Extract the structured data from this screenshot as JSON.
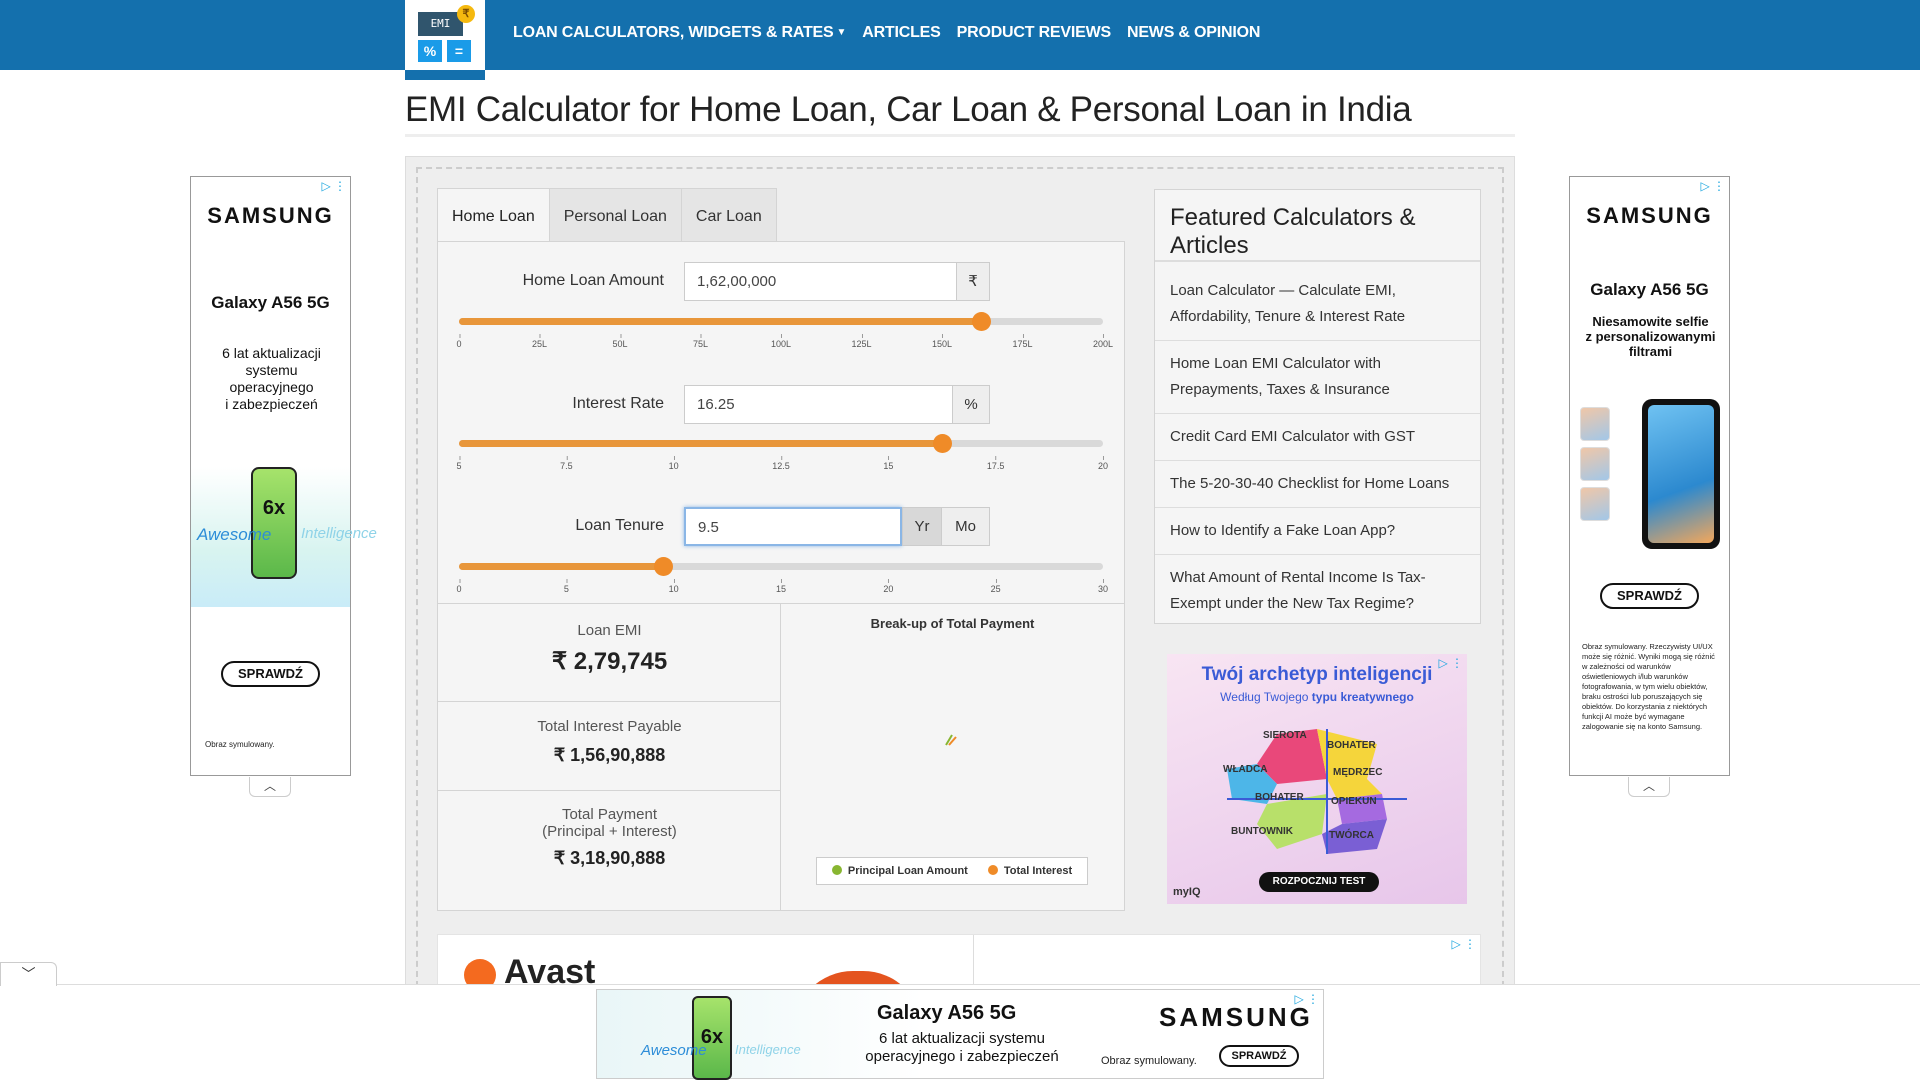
{
  "header": {
    "logo_screen": "EMI",
    "logo_coin": "₹",
    "logo_key1": "%",
    "logo_key2": "=",
    "nav": [
      {
        "label": "LOAN CALCULATORS, WIDGETS & RATES",
        "caret": true
      },
      {
        "label": "ARTICLES"
      },
      {
        "label": "PRODUCT REVIEWS"
      },
      {
        "label": "NEWS & OPINION"
      }
    ]
  },
  "page": {
    "title": "EMI Calculator for Home Loan, Car Loan & Personal Loan in India"
  },
  "calculator": {
    "tabs": [
      "Home Loan",
      "Personal Loan",
      "Car Loan"
    ],
    "active_tab": "Home Loan",
    "amount": {
      "label": "Home Loan Amount",
      "value": "1,62,00,000",
      "addon": "₹",
      "slider_fraction": 0.81,
      "ticks": [
        "0",
        "25L",
        "50L",
        "75L",
        "100L",
        "125L",
        "150L",
        "175L",
        "200L"
      ]
    },
    "rate": {
      "label": "Interest Rate",
      "value": "16.25",
      "addon": "%",
      "slider_fraction": 0.75,
      "ticks": [
        "5",
        "7.5",
        "10",
        "12.5",
        "15",
        "17.5",
        "20"
      ]
    },
    "tenure": {
      "label": "Loan Tenure",
      "value": "9.5",
      "addon_year": "Yr",
      "addon_month": "Mo",
      "slider_fraction": 0.3167,
      "ticks": [
        "0",
        "5",
        "10",
        "15",
        "20",
        "25",
        "30"
      ]
    },
    "results": {
      "emi_label": "Loan EMI",
      "emi_value": "₹ 2,79,745",
      "interest_label": "Total Interest Payable",
      "interest_value": "₹ 1,56,90,888",
      "total_label_1": "Total Payment",
      "total_label_2": "(Principal + Interest)",
      "total_value": "₹ 3,18,90,888"
    },
    "chart": {
      "title": "Break-up of Total Payment",
      "legend": [
        {
          "label": "Principal Loan Amount",
          "color": "#88b631"
        },
        {
          "label": "Total Interest",
          "color": "#ef8b28"
        }
      ]
    }
  },
  "featured": {
    "title": "Featured Calculators & Articles",
    "items": [
      "Loan Calculator — Calculate EMI, Affordability, Tenure & Interest Rate",
      "Home Loan EMI Calculator with Prepayments, Taxes & Insurance",
      "Credit Card EMI Calculator with GST",
      "The 5-20-30-40 Checklist for Home Loans",
      "How to Identify a Fake Loan App?",
      "What Amount of Rental Income Is Tax-Exempt under the New Tax Regime?"
    ]
  },
  "ads": {
    "left": {
      "brand": "SAMSUNG",
      "model": "Galaxy A56 5G",
      "copy_lines": [
        "6 lat aktualizacji",
        "systemu",
        "operacyjnego",
        "i zabezpieczeń"
      ],
      "phone_text": "6x",
      "awesome": "Awesome",
      "intelligence": "Intelligence",
      "button": "SPRAWDŹ",
      "small": "Obraz symulowany."
    },
    "right": {
      "brand": "SAMSUNG",
      "model": "Galaxy A56 5G",
      "copy_lines": [
        "Niesamowite selfie",
        "z personalizowanymi",
        "filtrami"
      ],
      "button": "SPRAWDŹ",
      "legal": "Obraz symulowany. Rzeczywisty UI/UX może się różnić. Wyniki mogą się różnić w zależności od warunków oświetleniowych i/lub warunków fotografowania, w tym wielu obiektów, braku ostrości lub poruszających się obiektów. Do korzystania z niektórych funkcji AI może być wymagane zalogowanie się na konto Samsung."
    },
    "square": {
      "title": "Twój archetyp inteligencji",
      "subtitle_prefix": "Według Twojego ",
      "subtitle_bold": "typu kreatywnego",
      "labels": [
        "SIEROTA",
        "BOHATER",
        "WŁADCA",
        "MĘDRZEC",
        "BOHATER",
        "OPIEKUN",
        "BUNTOWNIK",
        "TWÓRCA"
      ],
      "button": "ROZPOCZNIJ TEST",
      "logo": "myIQ"
    },
    "lower": {
      "brand": "Avast"
    },
    "bottom": {
      "model": "Galaxy A56 5G",
      "copy_lines": [
        "6 lat aktualizacji systemu",
        "operacyjnego i zabezpieczeń"
      ],
      "brand": "SAMSUNG",
      "small": "Obraz symulowany.",
      "button": "SPRAWDŹ",
      "phone_text": "6x",
      "awesome": "Awesome",
      "intelligence": "Intelligence"
    }
  }
}
